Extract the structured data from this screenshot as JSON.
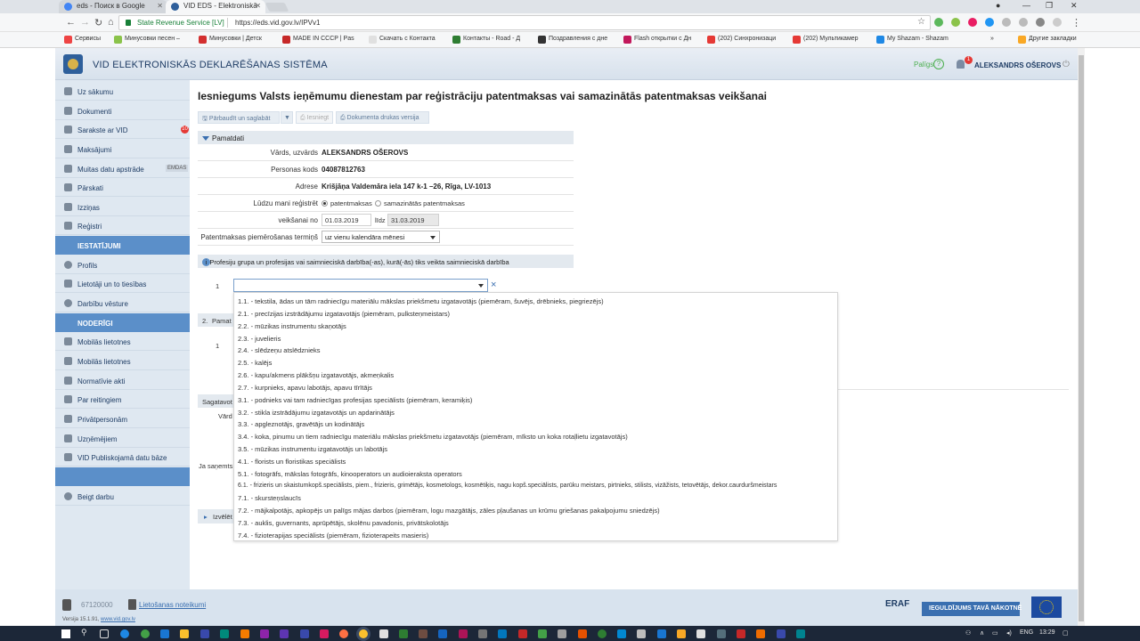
{
  "browser": {
    "tabs": [
      {
        "title": "eds - Поиск в Google",
        "active": false
      },
      {
        "title": "VID EDS - Elektroniskā",
        "active": true
      }
    ],
    "secure_label": "State Revenue Service [LV]",
    "url": "https://eds.vid.gov.lv/IPVv1",
    "bookmarks": [
      "Сервисы",
      "Минусовки песен –",
      "Минусовки | Детск",
      "MADE IN CCCP | Pas",
      "Скачать с Контакта",
      "Контакты - Road - Д",
      "Поздравления с дне",
      "Flash открытки с Дн",
      "(202) Синхронизаци",
      "(202) Мультикамер",
      "My Shazam - Shazam"
    ],
    "bookmarks_more": "»",
    "other_bookmarks": "Другие закладки"
  },
  "header": {
    "title": "VID ELEKTRONISKĀS DEKLARĒŠANAS SISTĒMA",
    "help": "Palīgs",
    "help_symbol": "?",
    "notifications": "1",
    "user": "ALEKSANDRS OŠEROVS"
  },
  "sidebar": {
    "items": [
      {
        "label": "Uz sākumu"
      },
      {
        "label": "Dokumenti"
      },
      {
        "label": "Sarakste ar VID",
        "badge": "10"
      },
      {
        "label": "Maksājumi"
      },
      {
        "label": "Muitas datu apstrāde",
        "tag": "EMDAS"
      },
      {
        "label": "Pārskati"
      },
      {
        "label": "Izziņas"
      },
      {
        "label": "Reģistri"
      }
    ],
    "section_settings": "IESTATĪJUMI",
    "settings_items": [
      {
        "label": "Profils"
      },
      {
        "label": "Lietotāji un to tiesības"
      },
      {
        "label": "Darbību vēsture"
      }
    ],
    "section_useful": "NODERĪGI",
    "useful_items": [
      {
        "label": "Mobilās lietotnes"
      },
      {
        "label": "Mobilās lietotnes"
      },
      {
        "label": "Normatīvie akti"
      },
      {
        "label": "Par reitingiem"
      },
      {
        "label": "Privātpersonām"
      },
      {
        "label": "Uzņēmējiem"
      },
      {
        "label": "VID Publiskojamā datu bāze"
      }
    ],
    "logout": "Beigt darbu"
  },
  "main": {
    "title": "Iesniegums Valsts ieņēmumu dienestam par reģistrāciju patentmaksas vai samazinātās patentmaksas veikšanai",
    "toolbar": {
      "check_save": "Pārbaudīt un saglabāt",
      "submit": "Iesniegt",
      "print": "Dokumenta drukas versija"
    },
    "basic": {
      "heading": "Pamatdati",
      "name_label": "Vārds, uzvārds",
      "name_value": "ALEKSANDRS OŠEROVS",
      "code_label": "Personas kods",
      "code_value": "04087812763",
      "address_label": "Adrese",
      "address_value": "Krišjāņa Valdemāra iela 147 k-1 –26, Rīga, LV-1013",
      "register_label": "Lūdzu mani reģistrēt",
      "option_patent": "patentmaksas",
      "option_reduced": "samazinātās patentmaksas",
      "period_label": "veikšanai no",
      "date_from": "01.03.2019",
      "until_label": "līdz",
      "date_to": "31.03.2019",
      "term_label": "Patentmaksas piemērošanas termiņš",
      "term_value": "uz vienu kalendāra mēnesi"
    },
    "profession": {
      "heading": "1.   Profesiju grupa un profesijas vai saimnieciskā darbība(-as), kurā(-ās) tiks veikta saimnieciskā darbība",
      "info": "i",
      "row_no": "1",
      "clear": "×"
    },
    "partial": {
      "section2_no": "2.",
      "section2_label": "Pamat",
      "row2_no": "1",
      "sagatavots": "Sagatavot",
      "vards": "Vārd",
      "ja_sanemts": "Ja saņemts",
      "izveleties": "Izvēlēt"
    },
    "dropdown_options": [
      "1.1. - tekstila, ādas un tām radniecīgu materiālu mākslas priekšmetu izgatavotājs (piemēram, šuvējs, drēbnieks, piegriezējs)",
      "2.1. - precīzijas izstrādājumu izgatavotājs (piemēram, pulksteņmeistars)",
      "2.2. - mūzikas instrumentu skaņotājs",
      "2.3. - juvelieris",
      "2.4. - slēdzeņu atslēdznieks",
      "2.5. - kalējs",
      "2.6. - kapu/akmens plākšņu izgatavotājs, akmeņkalis",
      "2.7. - kurpnieks, apavu labotājs, apavu tīrītājs",
      "3.1. - podnieks vai tam radniecīgas profesijas speciālists (piemēram, keramiķis)",
      "3.2. - stikla izstrādājumu izgatavotājs un apdarinātājs",
      "3.3. - apgleznotājs, gravētājs un kodinātājs",
      "3.4. - koka, pinumu un tiem radniecīgu materiālu mākslas priekšmetu izgatavotājs (piemēram, mīksto un koka rotaļlietu izgatavotājs)",
      "3.5. - mūzikas instrumentu izgatavotājs un labotājs",
      "4.1. - florists un floristikas speciālists",
      "5.1. - fotogrāfs, mākslas fotogrāfs, kinooperators un audioieraksta operators",
      "6.1. - frizieris un skaistumkopš.speciālists, piem., frizieris, grimētājs, kosmetologs, kosmētiķis, nagu kopš.speciālists, parūku meistars, pirtnieks, stilists, vizāžists, tetovētājs, dekor.caurduršmeistars",
      "7.1. - skursteņslaucīs",
      "7.2. - mājkalpotājs, apkopējs un palīgs mājas darbos (piemēram, logu mazgātājs, zāles pļaušanas un krūmu griešanas pakalpojumu sniedzējs)",
      "7.3. - auklis, guvernants, aprūpētājs, skolēnu pavadonis, privātskolotājs",
      "7.4. - fizioterapijas speciālists (piemēram, fizioterapeits masieris)"
    ]
  },
  "footer": {
    "phone": "67120000",
    "terms": "Lietošanas noteikumi",
    "version_label": "Versija 15.1.91",
    "version_link": "www.vid.gov.lv",
    "eraf": "ERAF",
    "slogan": "IEGULDĪJUMS TAVĀ NĀKOTNĒ"
  },
  "taskbar": {
    "lang": "ENG",
    "time": "13:29"
  }
}
